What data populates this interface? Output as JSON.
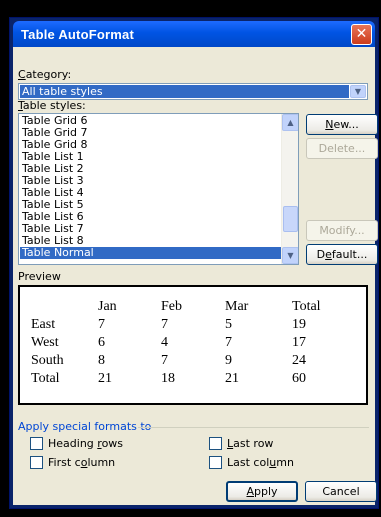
{
  "dialog": {
    "title": "Table AutoFormat",
    "close_glyph": "✕"
  },
  "category": {
    "label_ul": "C",
    "label_rest": "ategory:",
    "value": "All table styles"
  },
  "table_styles": {
    "label_ul": "T",
    "label_rest": "able styles:",
    "items": [
      "Table Grid 6",
      "Table Grid 7",
      "Table Grid 8",
      "Table List 1",
      "Table List 2",
      "Table List 3",
      "Table List 4",
      "Table List 5",
      "Table List 6",
      "Table List 7",
      "Table List 8",
      "Table Normal"
    ],
    "selected": "Table Normal"
  },
  "buttons": {
    "new_ul": "N",
    "new_rest": "ew...",
    "delete": "Delete...",
    "modify": "Modify...",
    "default_pre": "D",
    "default_ul": "e",
    "default_rest": "fault...",
    "apply_ul": "A",
    "apply_rest": "pply",
    "cancel": "Cancel"
  },
  "preview": {
    "label": "Preview",
    "rows": [
      [
        "",
        "Jan",
        "Feb",
        "Mar",
        "Total"
      ],
      [
        "East",
        "7",
        "7",
        "5",
        "19"
      ],
      [
        "West",
        "6",
        "4",
        "7",
        "17"
      ],
      [
        "South",
        "8",
        "7",
        "9",
        "24"
      ],
      [
        "Total",
        "21",
        "18",
        "21",
        "60"
      ]
    ]
  },
  "special_formats": {
    "label": "Apply special formats to",
    "heading_rows": {
      "pre": "Heading ",
      "ul": "r",
      "post": "ows"
    },
    "first_column": {
      "pre": "First c",
      "ul": "o",
      "post": "lumn"
    },
    "last_row": {
      "pre": "",
      "ul": "L",
      "post": "ast row"
    },
    "last_column": {
      "pre": "Last col",
      "ul": "u",
      "post": "mn"
    }
  },
  "icons": {
    "combo_arrow": "chevron-down-icon",
    "scroll_up": "chevron-up-icon",
    "scroll_down": "chevron-down-icon"
  },
  "colors": {
    "titlebar": "#0054e3",
    "selection": "#316ac5",
    "dialog_face": "#ece9d8",
    "group_label": "#0046d5"
  }
}
